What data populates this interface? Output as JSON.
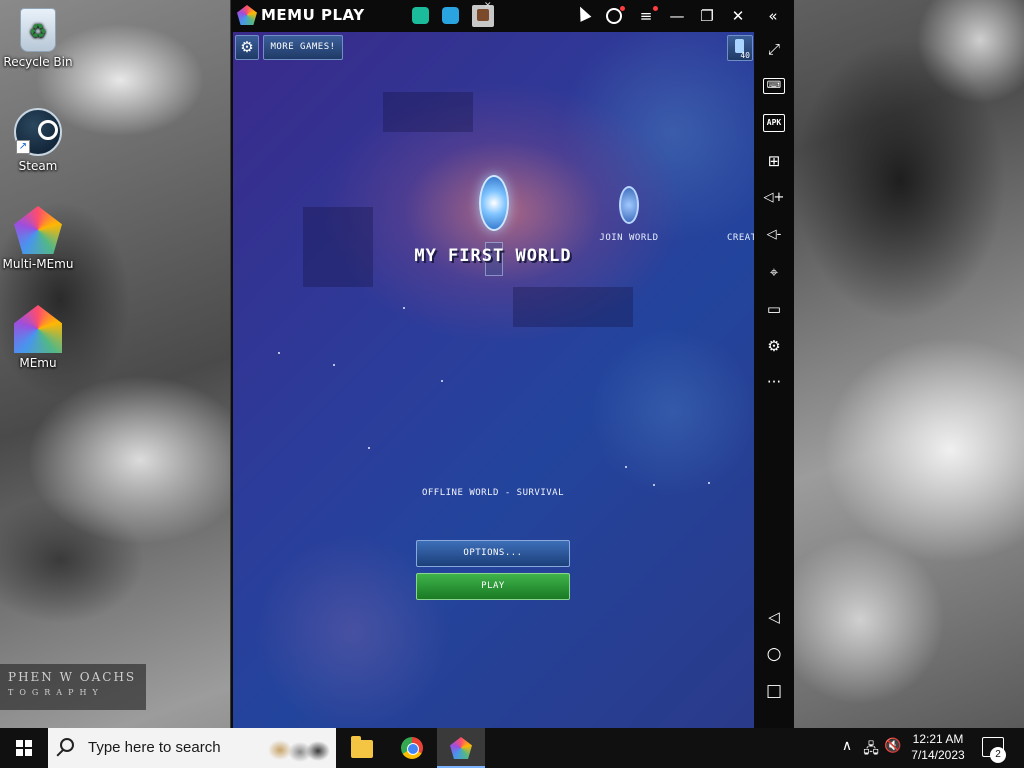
{
  "desktop": {
    "icons": [
      {
        "label": "Recycle Bin",
        "icon": "recycle-bin-icon"
      },
      {
        "label": "Steam",
        "icon": "steam-icon"
      },
      {
        "label": "Multi-MEmu",
        "icon": "multi-memu-icon"
      },
      {
        "label": "MEmu",
        "icon": "memu-icon"
      }
    ]
  },
  "memu": {
    "brand": "MEMU PLAY",
    "tabs": [
      "app-tab-1",
      "app-tab-2",
      "game-tab"
    ],
    "controls": {
      "account": "account-icon",
      "menu": "≡",
      "minimize": "—",
      "maximize": "❐",
      "close": "✕",
      "collapse": "«"
    },
    "sidebar": {
      "items": [
        {
          "name": "fullscreen",
          "glyph": "⤢"
        },
        {
          "name": "keyboard",
          "glyph": "⌨"
        },
        {
          "name": "apk",
          "glyph": "APK"
        },
        {
          "name": "multi-window",
          "glyph": "⊞"
        },
        {
          "name": "volume-up",
          "glyph": "◁+"
        },
        {
          "name": "volume-down",
          "glyph": "◁-"
        },
        {
          "name": "location",
          "glyph": "⌖"
        },
        {
          "name": "folder",
          "glyph": "▭"
        },
        {
          "name": "settings",
          "glyph": "⚙"
        },
        {
          "name": "more",
          "glyph": "···"
        },
        {
          "name": "back",
          "glyph": "◁"
        },
        {
          "name": "home",
          "glyph": "○"
        },
        {
          "name": "recents",
          "glyph": "□"
        }
      ]
    }
  },
  "game": {
    "more_games": "MORE GAMES!",
    "settings_icon": "⚙",
    "badge_count": "40",
    "world_title": "MY FIRST WORLD",
    "join_world": "JOIN WORLD",
    "create_partial": "CREAT",
    "world_subtitle": "OFFLINE WORLD - SURVIVAL",
    "options_label": "OPTIONS...",
    "play_label": "PLAY",
    "colors": {
      "play": "#2e9a38",
      "options": "#2d5aa0"
    }
  },
  "watermark": {
    "line1": "PHEN W OACHS",
    "line2": "TOGRAPHY"
  },
  "taskbar": {
    "search_placeholder": "Type here to search",
    "apps": [
      "file-explorer-icon",
      "chrome-icon",
      "memu-icon"
    ],
    "time": "12:21 AM",
    "date": "7/14/2023",
    "notification_count": "2"
  }
}
